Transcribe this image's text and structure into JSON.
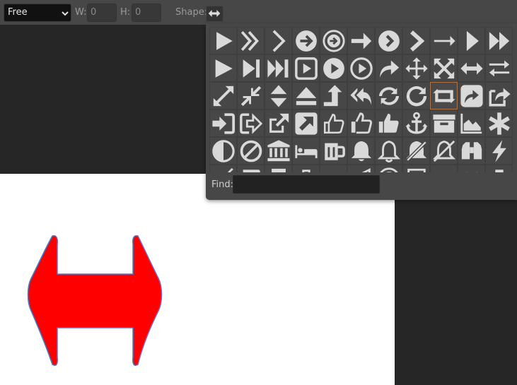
{
  "toolbar": {
    "mode_value": "Free",
    "width_label": "W:",
    "width_value": "0",
    "height_label": "H:",
    "height_value": "0",
    "shape_label": "Shape:"
  },
  "picker": {
    "find_label": "Find:",
    "find_value": "",
    "selected_index": 30,
    "icons": [
      "play-icon",
      "double-chevron-right-icon",
      "chevron-right-icon",
      "circle-arrow-right-icon",
      "circle-outline-arrow-right-icon",
      "arrow-right-icon",
      "circle-chevron-right-icon",
      "chevron-right-bold-icon",
      "long-arrow-right-icon",
      "caret-right-icon",
      "fast-forward-icon",
      "play-large-icon",
      "step-forward-icon",
      "fast-forward-end-icon",
      "play-square-icon",
      "play-circle-icon",
      "play-circle-outline-icon",
      "share-arrow-icon",
      "move-icon",
      "expand-arrows-icon",
      "arrows-h-icon",
      "exchange-icon",
      "expand-diagonal-icon",
      "compress-diagonal-icon",
      "sort-icon",
      "eject-icon",
      "level-up-icon",
      "reply-all-icon",
      "refresh-icon",
      "redo-icon",
      "retweet-icon",
      "share-square-icon",
      "share-square-outline-icon",
      "sign-in-icon",
      "sign-out-icon",
      "external-link-icon",
      "external-link-square-icon",
      "thumbs-up-outline-icon",
      "thumbs-o-up-icon",
      "thumbs-up-icon",
      "anchor-icon",
      "archive-icon",
      "area-chart-icon",
      "asterisk-icon",
      "adjust-icon",
      "ban-icon",
      "bank-icon",
      "bed-icon",
      "beer-icon",
      "bell-icon",
      "bell-outline-icon",
      "bell-slash-icon",
      "bell-slash-outline-icon",
      "binoculars-icon",
      "bolt-icon",
      "bomb-icon",
      "book-icon",
      "bookmark-icon",
      "briefcase-icon",
      "bug-icon",
      "bullhorn-icon",
      "bullseye-icon",
      "bus-icon",
      "calculator-icon",
      "calendar-icon",
      "camera-icon"
    ]
  },
  "canvas_shape": {
    "icon": "arrows-h-icon",
    "fill": "#ff0000",
    "stroke": "#5577cc"
  },
  "colors": {
    "toolbar": "#474747",
    "workspace": "#262626",
    "canvas": "#ffffff",
    "icon": "#d9d9d9",
    "selected_border": "#b4744a"
  }
}
